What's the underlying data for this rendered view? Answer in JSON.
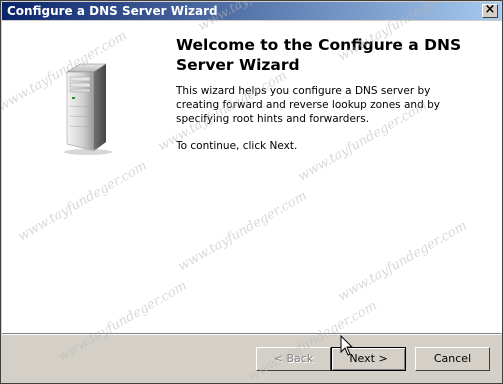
{
  "window": {
    "title": "Configure a DNS Server Wizard",
    "close_label": "×"
  },
  "main": {
    "heading": "Welcome to the Configure a DNS Server Wizard",
    "description": "This wizard helps you configure a DNS server by creating forward and reverse lookup zones and by specifying root hints and forwarders.",
    "continue_text": "To continue, click Next."
  },
  "buttons": {
    "back": "< Back",
    "next": "Next >",
    "cancel": "Cancel"
  },
  "watermark": {
    "text": "www.tayfundeger.com"
  },
  "icons": {
    "server": "server-icon",
    "close": "close-icon",
    "cursor": "mouse-cursor-icon"
  },
  "colors": {
    "titlebar_start": "#0a246a",
    "titlebar_end": "#a6caf0",
    "panel": "#ffffff",
    "chrome": "#d4d0c8"
  }
}
